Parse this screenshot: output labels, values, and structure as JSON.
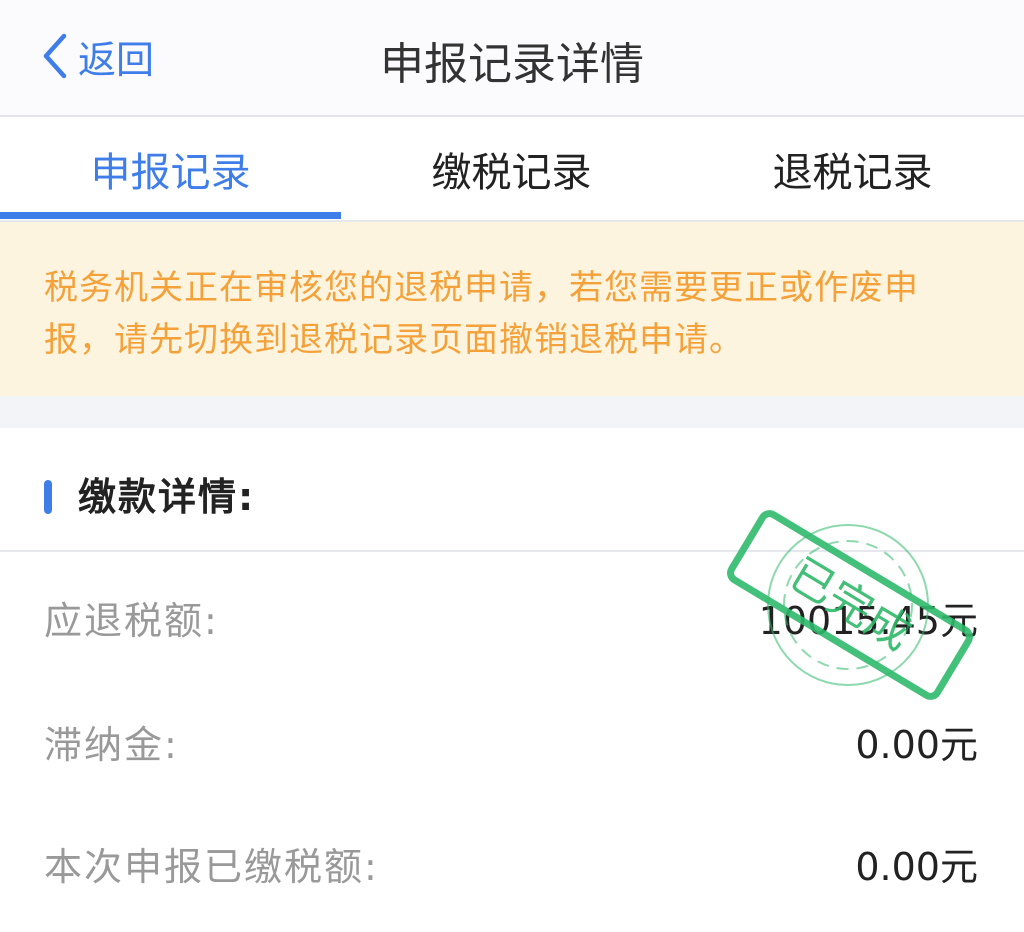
{
  "nav": {
    "back_label": "返回",
    "title": "申报记录详情"
  },
  "tabs": [
    {
      "label": "申报记录",
      "active": true
    },
    {
      "label": "缴税记录",
      "active": false
    },
    {
      "label": "退税记录",
      "active": false
    }
  ],
  "notice": {
    "text": "税务机关正在审核您的退税申请，若您需要更正或作废申报，请先切换到退税记录页面撤销退税申请。"
  },
  "section": {
    "title": "缴款详情:"
  },
  "details": [
    {
      "label": "应退税额:",
      "value": "10015.45元"
    },
    {
      "label": "滞纳金:",
      "value": "0.00元"
    },
    {
      "label": "本次申报已缴税额:",
      "value": "0.00元"
    }
  ],
  "stamp": {
    "text": "已完成",
    "color": "#2fb96a"
  },
  "colors": {
    "accent": "#3f7ee8",
    "notice_text": "#f4a13a",
    "notice_bg": "#fdf4df"
  }
}
